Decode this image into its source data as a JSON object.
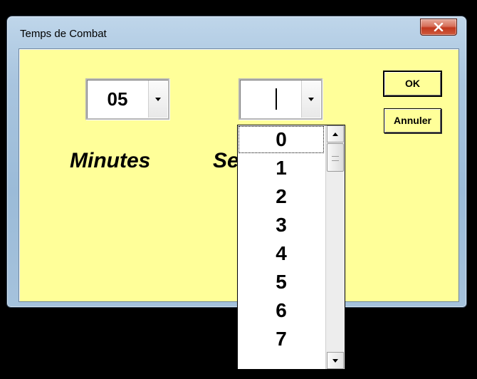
{
  "window": {
    "title": "Temps de Combat",
    "close_icon": "close-icon"
  },
  "minutes": {
    "value": "05",
    "label": "Minutes"
  },
  "seconds": {
    "value": "",
    "label_visible": "Se"
  },
  "buttons": {
    "ok": "OK",
    "cancel": "Annuler"
  },
  "dropdown": {
    "items": [
      "0",
      "1",
      "2",
      "3",
      "4",
      "5",
      "6",
      "7"
    ],
    "selected_index": 0
  },
  "colors": {
    "client_background": "#ffff99",
    "frame": "#a9c5df",
    "close_button": "#c1381e"
  }
}
